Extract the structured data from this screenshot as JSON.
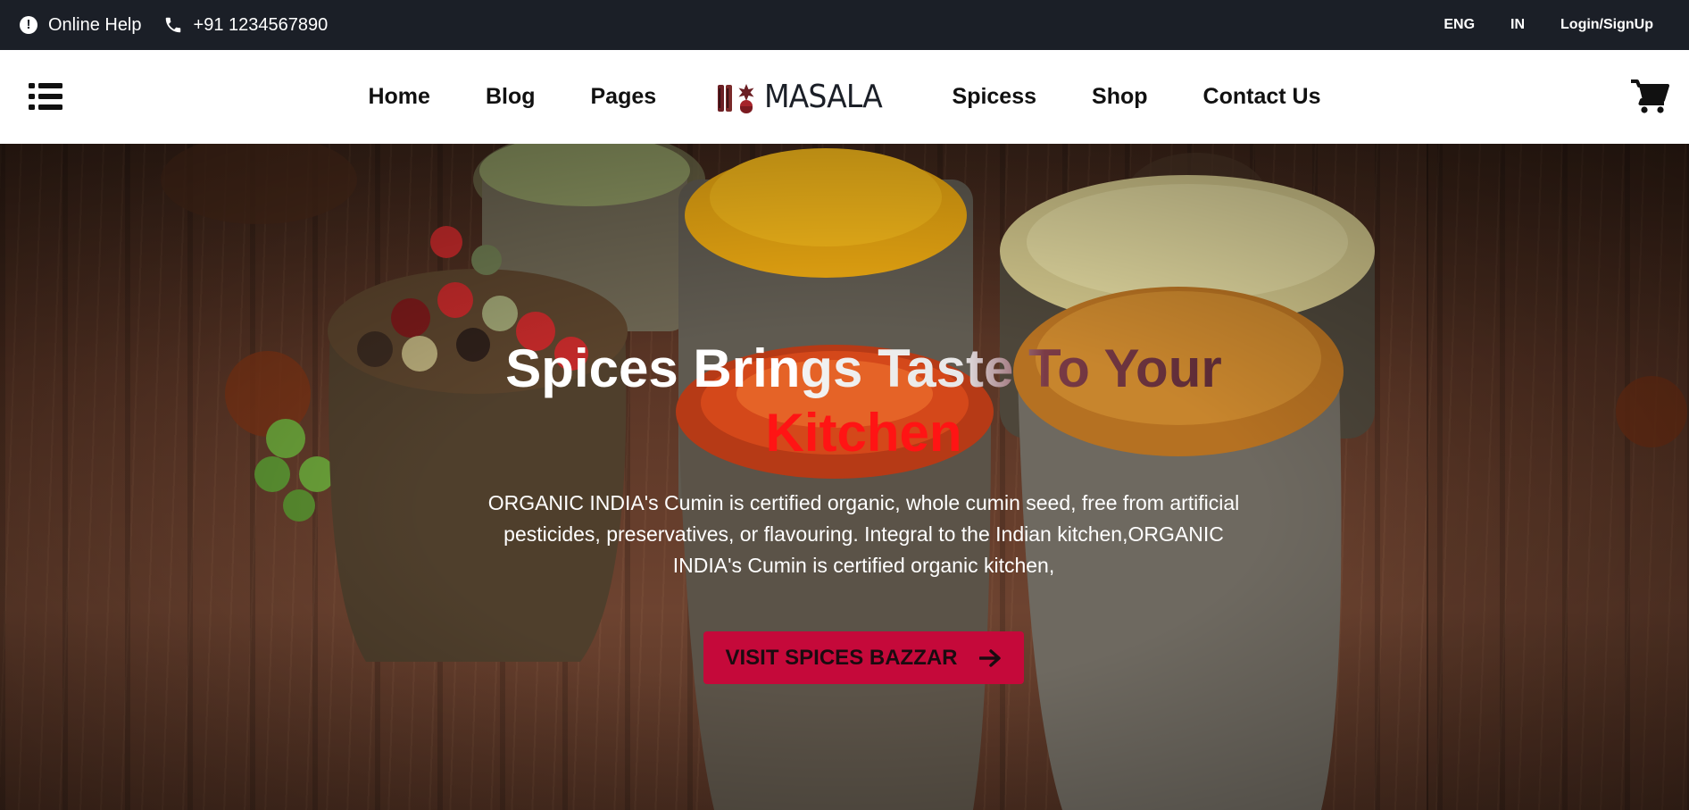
{
  "topbar": {
    "help_label": "Online Help",
    "phone": "+91 1234567890",
    "language": "ENG",
    "region": "IN",
    "login_label": "Login/SignUp"
  },
  "nav": {
    "items_left": [
      "Home",
      "Blog",
      "Pages"
    ],
    "logo_text": "MASALA",
    "items_right": [
      "Spicess",
      "Shop",
      "Contact Us"
    ]
  },
  "hero": {
    "title_part1": "Spices Brin",
    "title_part2": "gs Taste To Your",
    "title_accent": "Kitchen",
    "description": "ORGANIC INDIA's Cumin is certified organic, whole cumin seed, free from artificial pesticides, preservatives, or flavouring. Integral to the Indian kitchen,ORGANIC INDIA's Cumin is certified organic kitchen,",
    "cta_label": "VISIT SPICES BAZZAR"
  },
  "icons": {
    "help": "info-circle-icon",
    "phone": "phone-icon",
    "menu": "list-menu-icon",
    "cart": "shopping-cart-icon",
    "cta_arrow": "arrow-right-icon"
  },
  "colors": {
    "topbar_bg": "#1b1f27",
    "nav_bg": "#ffffff",
    "cta_bg": "#c5093a",
    "title_accent": "#ff1414"
  }
}
